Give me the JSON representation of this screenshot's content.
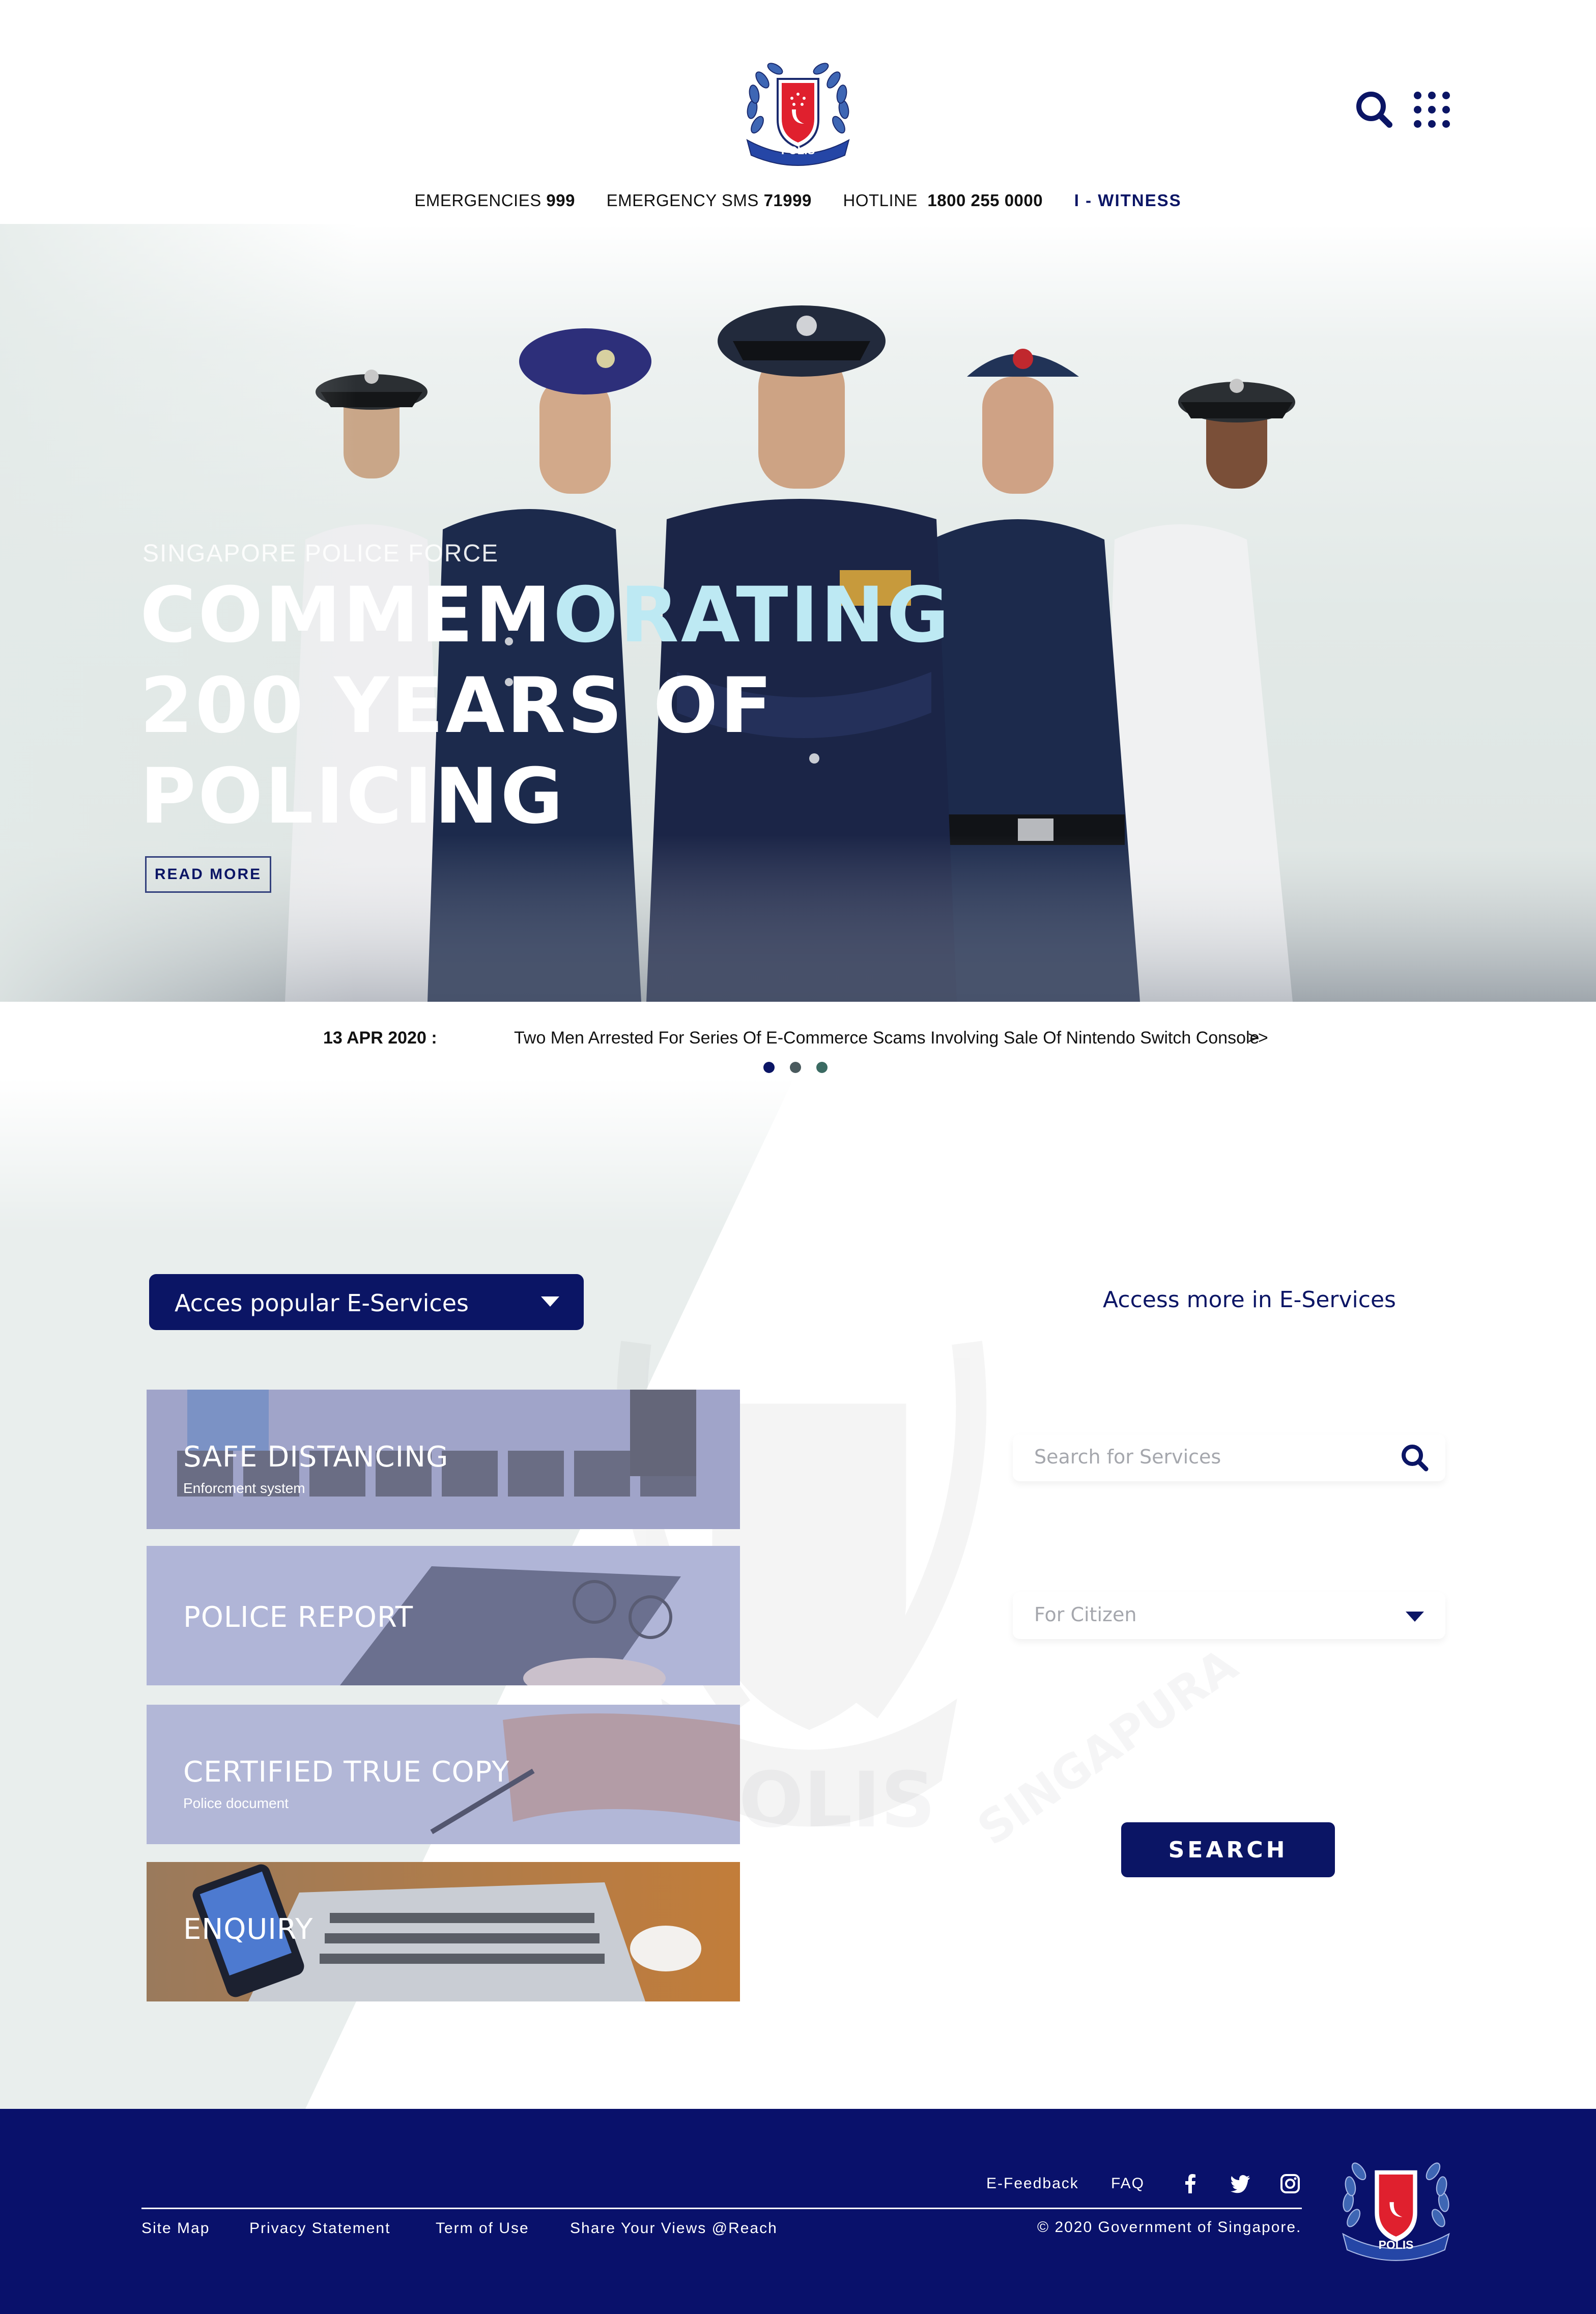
{
  "header": {
    "logo_text": "POLIS",
    "logo_ribbon_left": "SINGAPURA",
    "logo_ribbon_right": "SINGAPORE",
    "icons": [
      "search-icon",
      "apps-grid-icon"
    ]
  },
  "contact_bar": {
    "emergencies_label": "EMERGENCIES",
    "emergencies_number": "999",
    "sms_label": "EMERGENCY SMS",
    "sms_number": "71999",
    "hotline_label": "HOTLINE",
    "hotline_number": "1800 255 0000",
    "witness": "I - WITNESS"
  },
  "hero": {
    "eyebrow": "SINGAPORE POLICE FORCE",
    "title_line1_a": "COMMEM",
    "title_line1_b": "ORATING",
    "title_line2": "200 YEARS OF",
    "title_line3": "POLICING",
    "read_more": "READ MORE"
  },
  "news": {
    "date": "13 APR 2020 :",
    "headline": "Two Men Arrested For Series Of E-Commerce Scams Involving Sale Of Nintendo Switch Console",
    "more": ">>",
    "slides_total": 3,
    "active_slide": 1
  },
  "services": {
    "dropdown_label": "Acces popular E-Services",
    "cards": [
      {
        "title": "SAFE DISTANCING",
        "subtitle": "Enforcment system"
      },
      {
        "title": "POLICE REPORT",
        "subtitle": ""
      },
      {
        "title": "CERTIFIED TRUE COPY",
        "subtitle": "Police document"
      },
      {
        "title": "ENQUIRY",
        "subtitle": ""
      }
    ],
    "more_label": "Access more in E-Services",
    "search_placeholder": "Search for Services",
    "category_selected": "For Citizen",
    "search_button": "SEARCH",
    "watermark_text": "POLIS",
    "watermark_ribbon": "SINGAPURA"
  },
  "footer": {
    "feedback": "E-Feedback",
    "faq": "FAQ",
    "social_icons": [
      "facebook-icon",
      "twitter-icon",
      "instagram-icon"
    ],
    "links": [
      "Site Map",
      "Privacy Statement",
      "Term of Use",
      "Share Your Views @Reach"
    ],
    "copyright": "© 2020 Government of Singapore."
  },
  "colors": {
    "brand_navy": "#0b1565",
    "footer_navy": "#09116b",
    "crest_red": "#e0202e",
    "hero_accent": "#bde9f3"
  }
}
